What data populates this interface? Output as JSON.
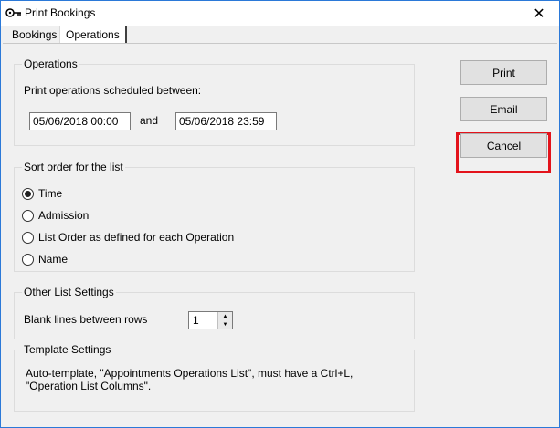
{
  "window": {
    "title": "Print Bookings",
    "close_label": "✕"
  },
  "tabs": [
    {
      "label": "Bookings"
    },
    {
      "label": "Operations"
    }
  ],
  "operations": {
    "group_title": "Operations",
    "prompt": "Print operations scheduled between:",
    "start_value": "05/06/2018 00:00",
    "and_label": "and",
    "end_value": "05/06/2018 23:59"
  },
  "sort": {
    "group_title": "Sort order for the list",
    "options": [
      {
        "label": "Time",
        "checked": true
      },
      {
        "label": "Admission",
        "checked": false
      },
      {
        "label": "List Order as defined for each Operation",
        "checked": false
      },
      {
        "label": "Name",
        "checked": false
      }
    ]
  },
  "other": {
    "group_title": "Other List Settings",
    "blank_lines_label": "Blank lines between rows",
    "blank_lines_value": "1"
  },
  "template": {
    "group_title": "Template Settings",
    "text": "Auto-template,  \"Appointments Operations List\", must have a Ctrl+L, \"Operation List Columns\"."
  },
  "buttons": {
    "print": "Print",
    "email": "Email",
    "cancel": "Cancel"
  },
  "colors": {
    "highlight": "#e3131b",
    "title_border": "#2b79d8"
  }
}
